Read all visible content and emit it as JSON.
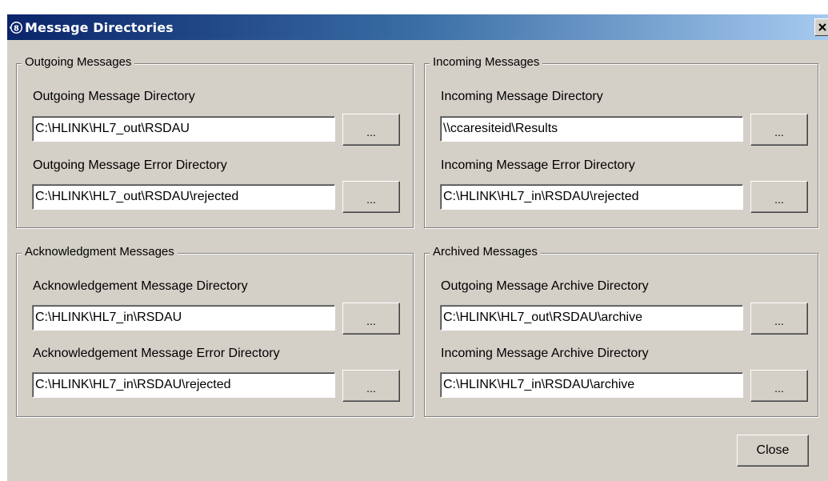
{
  "window": {
    "title": "Message Directories",
    "titlebar_colors": {
      "start": "#0a246a",
      "end": "#a6caf0"
    },
    "app_icon": "hl7-app-icon",
    "close_icon": "close-x-icon"
  },
  "browse_label": "...",
  "groups": {
    "outgoing": {
      "legend": "Outgoing Messages",
      "dir_label": "Outgoing Message Directory",
      "dir_value": "C:\\HLINK\\HL7_out\\RSDAU",
      "err_label": "Outgoing Message Error Directory",
      "err_value": "C:\\HLINK\\HL7_out\\RSDAU\\rejected"
    },
    "incoming": {
      "legend": "Incoming Messages",
      "dir_label": "Incoming Message Directory",
      "dir_value": "\\\\ccaresiteid\\Results",
      "err_label": "Incoming Message Error Directory",
      "err_value": "C:\\HLINK\\HL7_in\\RSDAU\\rejected"
    },
    "ack": {
      "legend": "Acknowledgment Messages",
      "dir_label": "Acknowledgement Message Directory",
      "dir_value": "C:\\HLINK\\HL7_in\\RSDAU",
      "err_label": "Acknowledgement Message Error Directory",
      "err_value": "C:\\HLINK\\HL7_in\\RSDAU\\rejected"
    },
    "archived": {
      "legend": "Archived Messages",
      "dir_label": "Outgoing Message Archive Directory",
      "dir_value": "C:\\HLINK\\HL7_out\\RSDAU\\archive",
      "err_label": "Incoming Message Archive Directory",
      "err_value": "C:\\HLINK\\HL7_in\\RSDAU\\archive"
    }
  },
  "footer": {
    "close_label": "Close"
  }
}
